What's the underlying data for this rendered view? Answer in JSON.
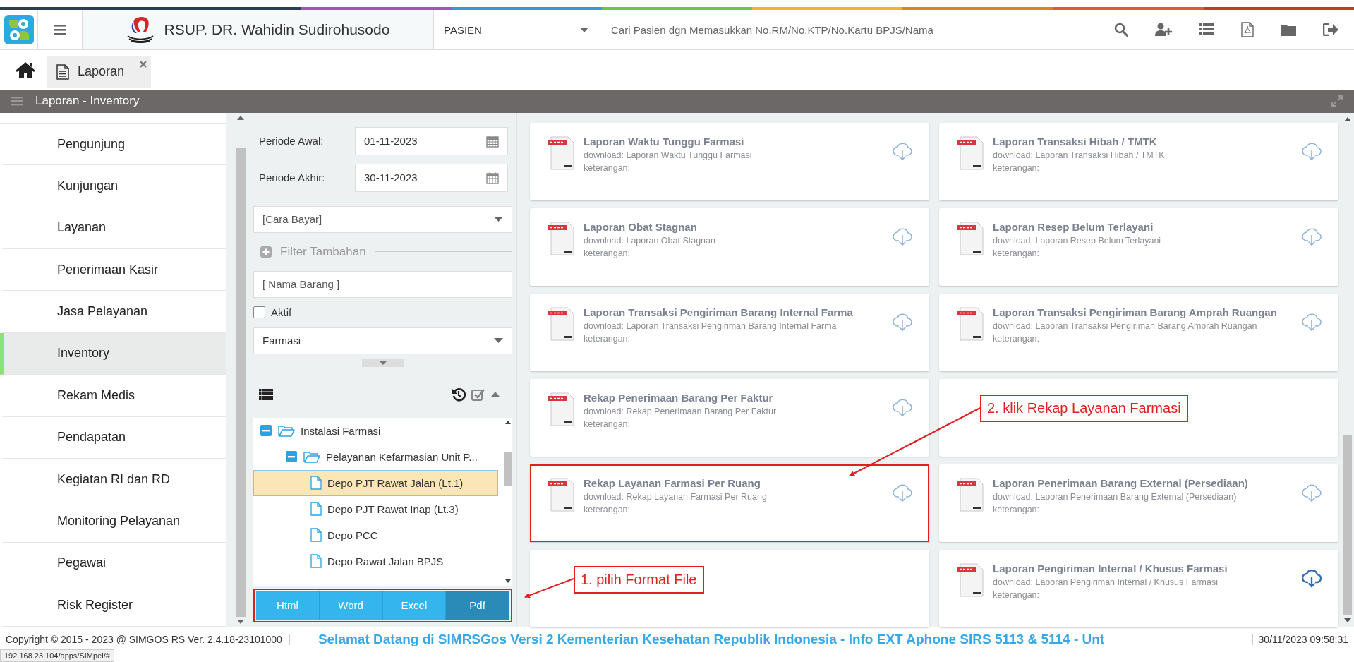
{
  "header": {
    "hospital_name": "RSUP. DR. Wahidin Sudirohusodo",
    "patient_select": {
      "value": "PASIEN"
    },
    "search": {
      "placeholder": "Cari Pasien dgn Memasukkan No.RM/No.KTP/No.Kartu BPJS/Nama"
    }
  },
  "tabs": [
    {
      "label": "Laporan",
      "selected": true
    }
  ],
  "panel_title": "Laporan - Inventory",
  "sidebar": {
    "items": [
      {
        "label": "Pengunjung",
        "selected": false
      },
      {
        "label": "Kunjungan",
        "selected": false
      },
      {
        "label": "Layanan",
        "selected": false
      },
      {
        "label": "Penerimaan Kasir",
        "selected": false
      },
      {
        "label": "Jasa Pelayanan",
        "selected": false
      },
      {
        "label": "Inventory",
        "selected": true
      },
      {
        "label": "Rekam Medis",
        "selected": false
      },
      {
        "label": "Pendapatan",
        "selected": false
      },
      {
        "label": "Kegiatan RI dan RD",
        "selected": false
      },
      {
        "label": "Monitoring Pelayanan",
        "selected": false
      },
      {
        "label": "Pegawai",
        "selected": false
      },
      {
        "label": "Risk Register",
        "selected": false
      }
    ]
  },
  "filters": {
    "periode_awal": {
      "label": "Periode Awal:",
      "value": "01-11-2023"
    },
    "periode_akhir": {
      "label": "Periode Akhir:",
      "value": "30-11-2023"
    },
    "cara_bayar": {
      "placeholder": "[Cara Bayar]"
    },
    "filter_tambahan": "Filter Tambahan",
    "nama_barang": {
      "placeholder": "[ Nama Barang ]"
    },
    "aktif": {
      "label": "Aktif",
      "checked": false
    },
    "unit": {
      "value": "Farmasi"
    }
  },
  "tree": {
    "nodes": [
      {
        "label": "Instalasi Farmasi",
        "expanded": true,
        "children": [
          {
            "label": "Pelayanan Kefarmasian Unit P...",
            "expanded": true,
            "children": [
              {
                "label": "Depo PJT Rawat Jalan (Lt.1)",
                "selected": true
              },
              {
                "label": "Depo PJT Rawat Inap (Lt.3)",
                "selected": false
              },
              {
                "label": "Depo PCC",
                "selected": false
              },
              {
                "label": "Depo Rawat Jalan BPJS",
                "selected": false
              }
            ]
          }
        ]
      }
    ]
  },
  "format_bar": {
    "highlighted": true,
    "buttons": [
      {
        "label": "Html",
        "selected": false
      },
      {
        "label": "Word",
        "selected": false
      },
      {
        "label": "Excel",
        "selected": false
      },
      {
        "label": "Pdf",
        "selected": true
      }
    ]
  },
  "reports": {
    "columns": [
      [
        {
          "kind": "report",
          "title": "Laporan Waktu Tunggu Farmasi",
          "download": "download: Laporan Waktu Tunggu Farmasi",
          "note": "keterangan:",
          "highlighted": false,
          "active": false
        },
        {
          "kind": "report",
          "title": "Laporan Obat Stagnan",
          "download": "download: Laporan Obat Stagnan",
          "note": "keterangan:",
          "highlighted": false,
          "active": false
        },
        {
          "kind": "report",
          "title": "Laporan Transaksi Pengiriman Barang Internal Farma",
          "download": "download: Laporan Transaksi Pengiriman Barang Internal Farma",
          "note": "keterangan:",
          "highlighted": false,
          "active": false
        },
        {
          "kind": "report",
          "title": "Rekap Penerimaan Barang Per Faktur",
          "download": "download: Rekap Penerimaan Barang Per Faktur",
          "note": "keterangan:",
          "highlighted": false,
          "active": false
        },
        {
          "kind": "report",
          "title": "Rekap Layanan Farmasi Per Ruang",
          "download": "download: Rekap Layanan Farmasi Per Ruang",
          "note": "keterangan:",
          "highlighted": true,
          "active": false
        },
        {
          "kind": "empty"
        }
      ],
      [
        {
          "kind": "report",
          "title": "Laporan Transaksi Hibah / TMTK",
          "download": "download: Laporan Transaksi Hibah / TMTK",
          "note": "keterangan:",
          "highlighted": false,
          "active": false
        },
        {
          "kind": "report",
          "title": "Laporan Resep Belum Terlayani",
          "download": "download: Laporan Resep Belum Terlayani",
          "note": "keterangan:",
          "highlighted": false,
          "active": false
        },
        {
          "kind": "report",
          "title": "Laporan Transaksi Pengiriman Barang Amprah Ruangan",
          "download": "download: Laporan Transaksi Pengiriman Barang Amprah Ruangan",
          "note": "keterangan:",
          "highlighted": false,
          "active": false
        },
        {
          "kind": "empty"
        },
        {
          "kind": "report",
          "title": "Laporan Penerimaan Barang External (Persediaan)",
          "download": "download: Laporan Penerimaan Barang External (Persediaan)",
          "note": "keterangan:",
          "highlighted": false,
          "active": false
        },
        {
          "kind": "report",
          "title": "Laporan Pengiriman Internal / Khusus Farmasi",
          "download": "download: Laporan Pengiriman Internal / Khusus Farmasi",
          "note": "keterangan:",
          "highlighted": false,
          "active": true
        }
      ]
    ]
  },
  "annotations": [
    {
      "text": "1. pilih Format File"
    },
    {
      "text": "2. klik Rekap Layanan Farmasi"
    }
  ],
  "footer": {
    "copyright": "Copyright © 2015 - 2023 @ SIMGOS RS Ver. 2.4.18-23101000",
    "marquee": "Selamat Datang di SIMRSGos Versi 2 Kementerian Kesehatan Republik Indonesia - Info EXT Aphone SIRS 5113 & 5114 - Unt",
    "datetime": "30/11/2023 09:58:31"
  },
  "status_url": "192.168.23.104/apps/SIMpel/#"
}
